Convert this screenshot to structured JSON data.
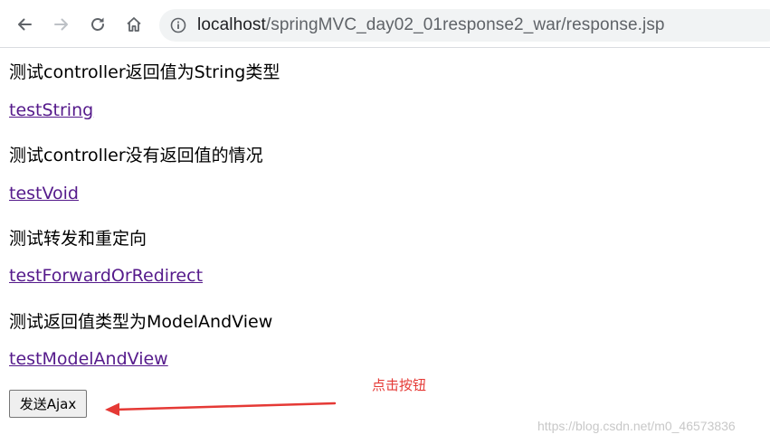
{
  "browser": {
    "url_host": "localhost",
    "url_path": "/springMVC_day02_01response2_war/response.jsp"
  },
  "page": {
    "items": [
      {
        "heading": "测试controller返回值为String类型",
        "link": "testString"
      },
      {
        "heading": "测试controller没有返回值的情况",
        "link": "testVoid"
      },
      {
        "heading": "测试转发和重定向",
        "link": "testForwardOrRedirect"
      },
      {
        "heading": "测试返回值类型为ModelAndView",
        "link": "testModelAndView"
      }
    ],
    "ajax_button": "发送Ajax"
  },
  "annotation": {
    "text": "点击按钮",
    "color": "#e53935"
  },
  "watermark": "https://blog.csdn.net/m0_46573836",
  "colors": {
    "link_visited": "#551a8b",
    "toolbar_bg": "#ffffff",
    "omnibox_bg": "#f1f3f4"
  }
}
